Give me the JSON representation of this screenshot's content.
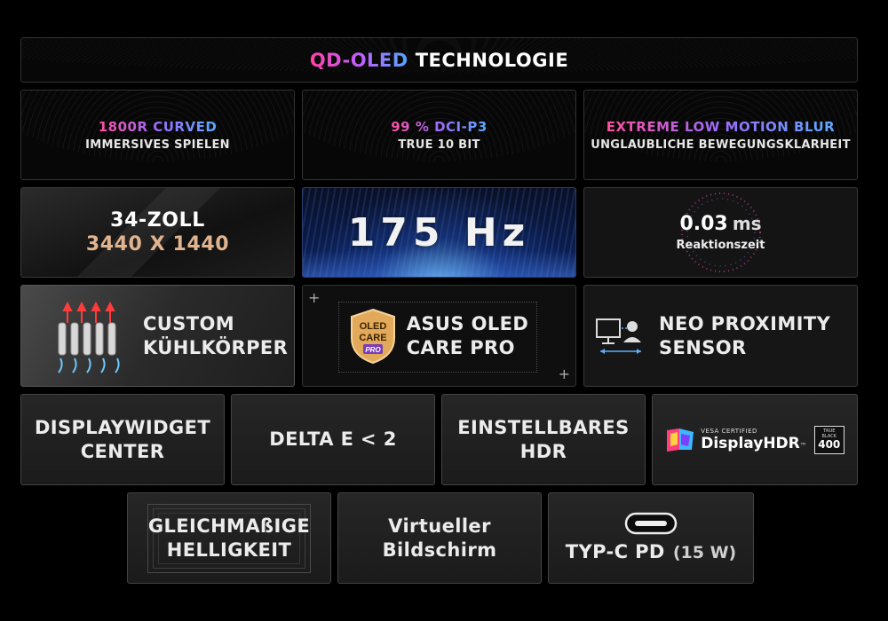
{
  "header": {
    "title_gradient": "QD-OLED",
    "title_rest": "TECHNOLOGIE"
  },
  "row1": [
    {
      "title": "1800R CURVED",
      "subtitle": "IMMERSIVES SPIELEN"
    },
    {
      "title": "99 % DCI-P3",
      "subtitle": "TRUE 10 BIT"
    },
    {
      "title": "EXTREME LOW MOTION BLUR",
      "subtitle": "UNGLAUBLICHE BEWEGUNGSKLARHEIT"
    }
  ],
  "row2": {
    "size_line1": "34-ZOLL",
    "size_line2": "3440 X 1440",
    "refresh": "175 Hz",
    "response_value": "0.03",
    "response_unit": "ms",
    "response_label": "Reaktionszeit"
  },
  "row3": {
    "cooling_line1": "CUSTOM",
    "cooling_line2": "KÜHLKÖRPER",
    "oled_badge_line1": "OLED",
    "oled_badge_line2": "CARE",
    "oled_badge_line3": "PRO",
    "oled_line1": "ASUS OLED",
    "oled_line2": "CARE PRO",
    "sensor_line1": "NEO PROXIMITY",
    "sensor_line2": "SENSOR"
  },
  "row4": {
    "widget_line1": "DISPLAYWIDGET",
    "widget_line2": "CENTER",
    "delta": "DELTA E < 2",
    "hdr_line1": "EINSTELLBARES",
    "hdr_line2": "HDR",
    "vesa_top": "VESA CERTIFIED",
    "vesa_main": "DisplayHDR",
    "vesa_tm": "™",
    "vesa_badge_top1": "TRUE",
    "vesa_badge_top2": "BLACK",
    "vesa_badge_num": "400"
  },
  "row5": {
    "bright_line1": "GLEICHMAßIGE",
    "bright_line2": "HELLIGKEIT",
    "virtual_line1": "Virtueller",
    "virtual_line2": "Bildschirm",
    "typec_main": "TYP-C PD",
    "typec_power": "(15 W)"
  },
  "colors": {
    "copper": "#e1b48f",
    "pink": "#ff3fa4",
    "blue": "#4fa6ff"
  }
}
